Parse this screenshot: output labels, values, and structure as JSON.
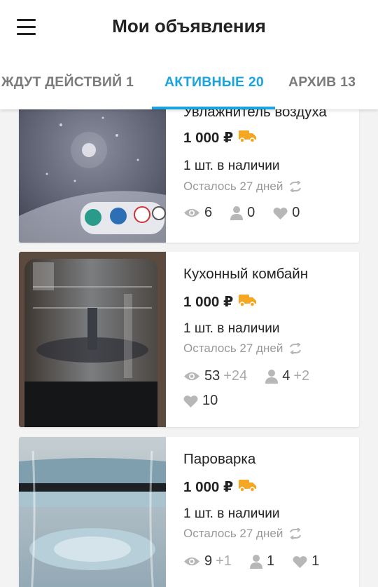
{
  "header": {
    "title": "Мои объявления",
    "menu_icon": "hamburger-icon"
  },
  "tabs": [
    {
      "label": "ЖДУТ ДЕЙСТВИЙ 1",
      "active": false
    },
    {
      "label": "АКТИВНЫЕ 20",
      "active": true
    },
    {
      "label": "АРХИВ 13",
      "active": false
    }
  ],
  "colors": {
    "accent": "#1aa3dc",
    "delivery": "#f5a623",
    "muted": "#999999"
  },
  "ads": [
    {
      "title": "Увлажнитель воздуха",
      "price": "1 000 ₽",
      "stock": "1 шт. в наличии",
      "days_left": "Осталось 27 дней",
      "views": "6",
      "views_delta": "",
      "contacts": "0",
      "contacts_delta": "",
      "favorites": "0"
    },
    {
      "title": "Кухонный комбайн",
      "price": "1 000 ₽",
      "stock": "1 шт. в наличии",
      "days_left": "Осталось 27 дней",
      "views": "53",
      "views_delta": "+24",
      "contacts": "4",
      "contacts_delta": "+2",
      "favorites": "10"
    },
    {
      "title": "Пароварка",
      "price": "1 000 ₽",
      "stock": "1 шт. в наличии",
      "days_left": "Осталось 27 дней",
      "views": "9",
      "views_delta": "+1",
      "contacts": "1",
      "contacts_delta": "",
      "favorites": "1"
    }
  ]
}
